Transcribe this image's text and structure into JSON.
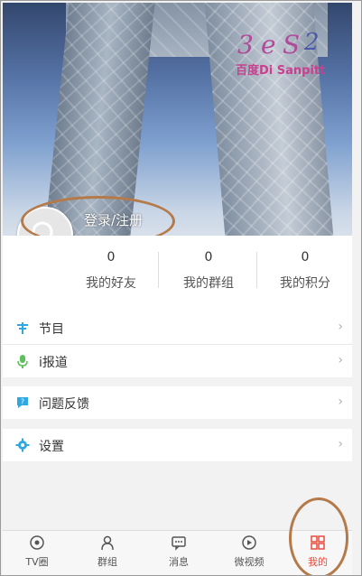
{
  "profile": {
    "login_label": "登录/注册"
  },
  "watermark": {
    "text": "百度Di Sanpitt"
  },
  "stats": [
    {
      "value": "0",
      "label": "我的好友"
    },
    {
      "value": "0",
      "label": "我的群组"
    },
    {
      "value": "0",
      "label": "我的积分"
    }
  ],
  "menu": {
    "group1": [
      {
        "label": "节目",
        "icon": "program-icon",
        "color": "#2fa8e0"
      },
      {
        "label": "i报道",
        "icon": "microphone-icon",
        "color": "#5cc05c"
      }
    ],
    "group2": [
      {
        "label": "问题反馈",
        "icon": "feedback-icon",
        "color": "#2fa8e0"
      }
    ],
    "group3": [
      {
        "label": "设置",
        "icon": "gear-icon",
        "color": "#2fa8e0"
      }
    ]
  },
  "tabs": [
    {
      "label": "TV圈",
      "icon": "tv-circle-icon"
    },
    {
      "label": "群组",
      "icon": "group-icon"
    },
    {
      "label": "消息",
      "icon": "message-icon"
    },
    {
      "label": "微视频",
      "icon": "video-icon"
    },
    {
      "label": "我的",
      "icon": "mine-icon",
      "active": true
    }
  ],
  "colors": {
    "accent": "#e84b3c",
    "annotation": "#b47a4a"
  }
}
